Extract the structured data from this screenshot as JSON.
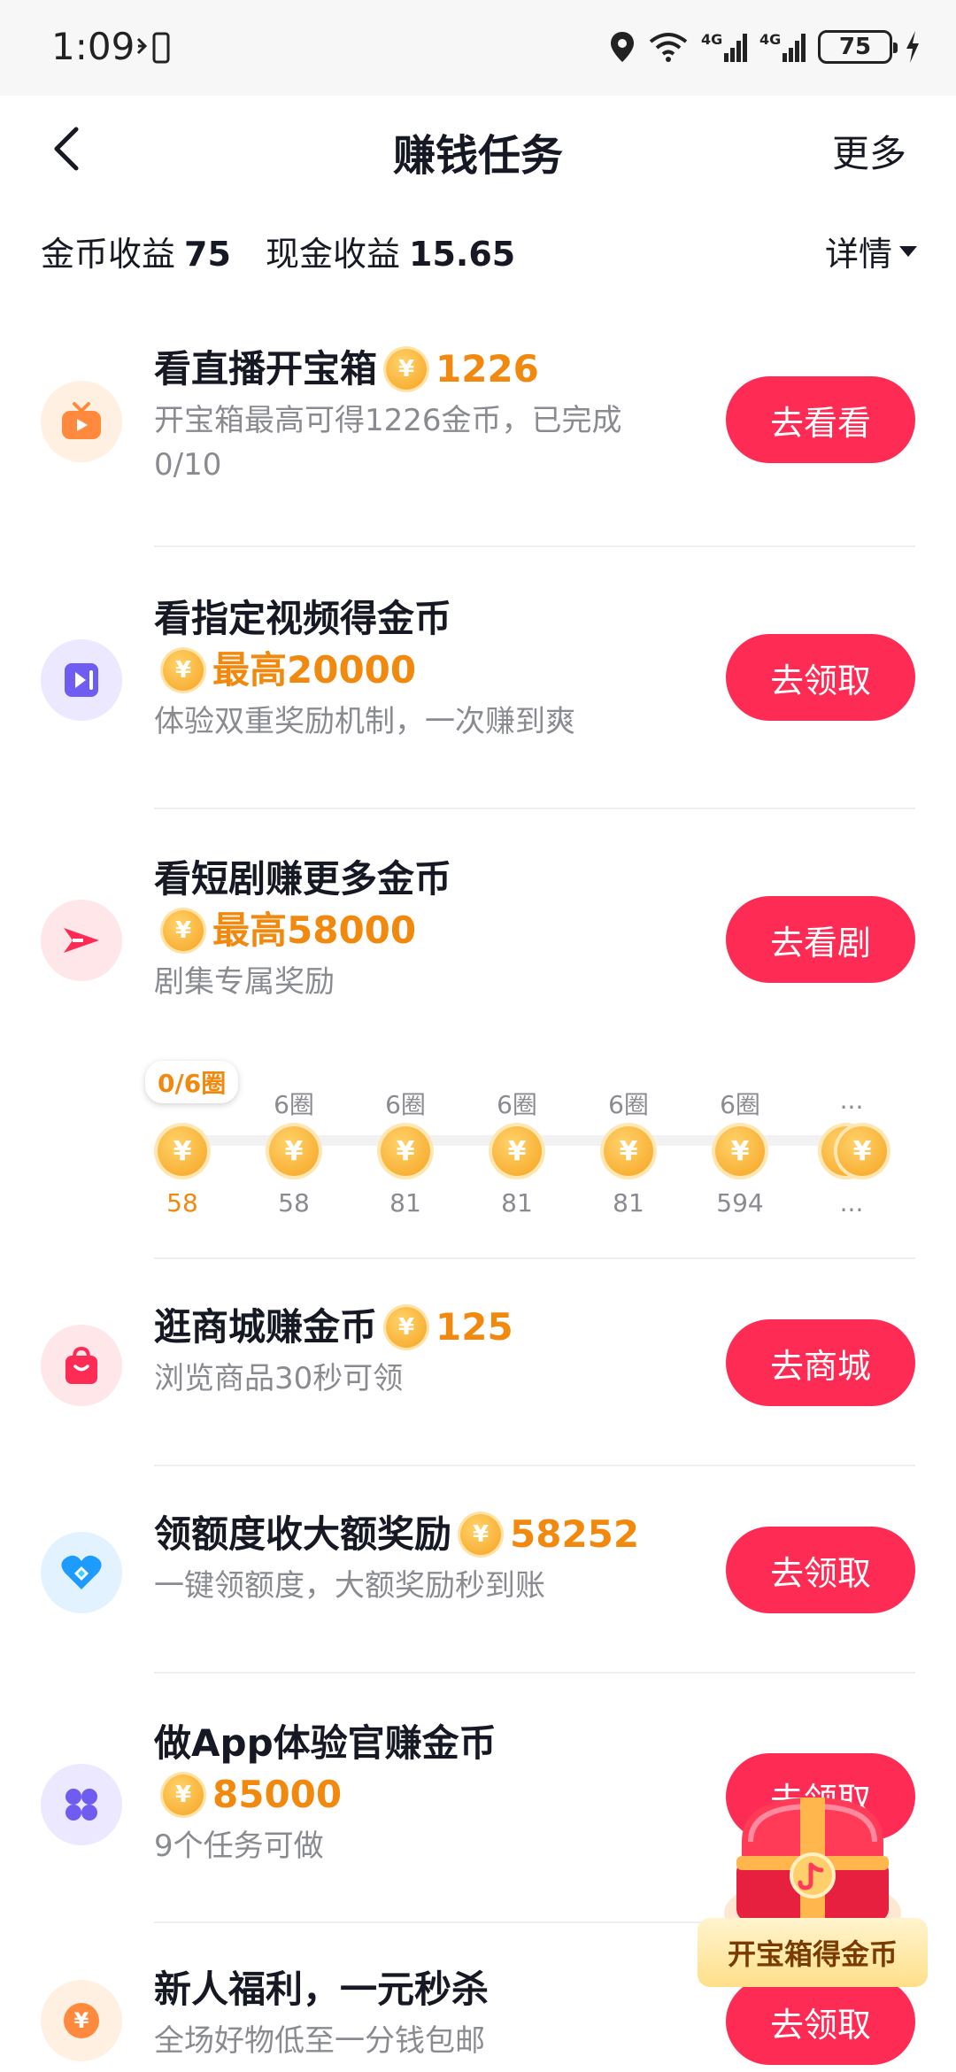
{
  "status_bar": {
    "time": "1:09",
    "battery": "75"
  },
  "header": {
    "title": "赚钱任务",
    "more": "更多"
  },
  "earnings": {
    "coin_label": "金币收益",
    "coin_value": "75",
    "cash_label": "现金收益",
    "cash_value": "15.65",
    "details": "详情"
  },
  "tasks": [
    {
      "title": "看直播开宝箱",
      "reward": "1226",
      "desc": "开宝箱最高可得1226金币，已完成0/10",
      "button": "去看看",
      "icon": "tv-icon",
      "icon_color": "#ff8a3d"
    },
    {
      "title": "看指定视频得金币",
      "reward": "最高20000",
      "desc": "体验双重奖励机制，一次赚到爽",
      "button": "去领取",
      "icon": "video-icon",
      "icon_color": "#6f5cf1"
    },
    {
      "title": "看短剧赚更多金币",
      "reward": "最高58000",
      "desc": "剧集专属奖励",
      "button": "去看剧",
      "icon": "play-arrow-icon",
      "icon_color": "#fe2c55"
    },
    {
      "title": "逛商城赚金币",
      "reward": "125",
      "desc": "浏览商品30秒可领",
      "button": "去商城",
      "icon": "shopping-bag-icon",
      "icon_color": "#fe2c55"
    },
    {
      "title": "领额度收大额奖励",
      "reward": "58252",
      "desc": "一键领额度，大额奖励秒到账",
      "button": "去领取",
      "icon": "heart-diamond-icon",
      "icon_color": "#1e9bff"
    },
    {
      "title": "做App体验官赚金币",
      "reward": "85000",
      "desc": "9个任务可做",
      "button": "去领取",
      "icon": "grid-flower-icon",
      "icon_color": "#6f5cf1"
    },
    {
      "title": "新人福利，一元秒杀",
      "desc": "全场好物低至一分钱包邮",
      "button": "去领取",
      "icon": "yuan-icon",
      "icon_color": "#ff8a3d"
    }
  ],
  "progress": {
    "current_label": "0/6圈",
    "nodes": [
      {
        "label": "",
        "value": "58"
      },
      {
        "label": "6圈",
        "value": "58"
      },
      {
        "label": "6圈",
        "value": "81"
      },
      {
        "label": "6圈",
        "value": "81"
      },
      {
        "label": "6圈",
        "value": "81"
      },
      {
        "label": "6圈",
        "value": "594"
      },
      {
        "label": "...",
        "value": "..."
      }
    ]
  },
  "floating": {
    "chest_caption": "开宝箱得金币"
  },
  "colors": {
    "accent": "#fe2c55",
    "coin": "#f2890f"
  }
}
